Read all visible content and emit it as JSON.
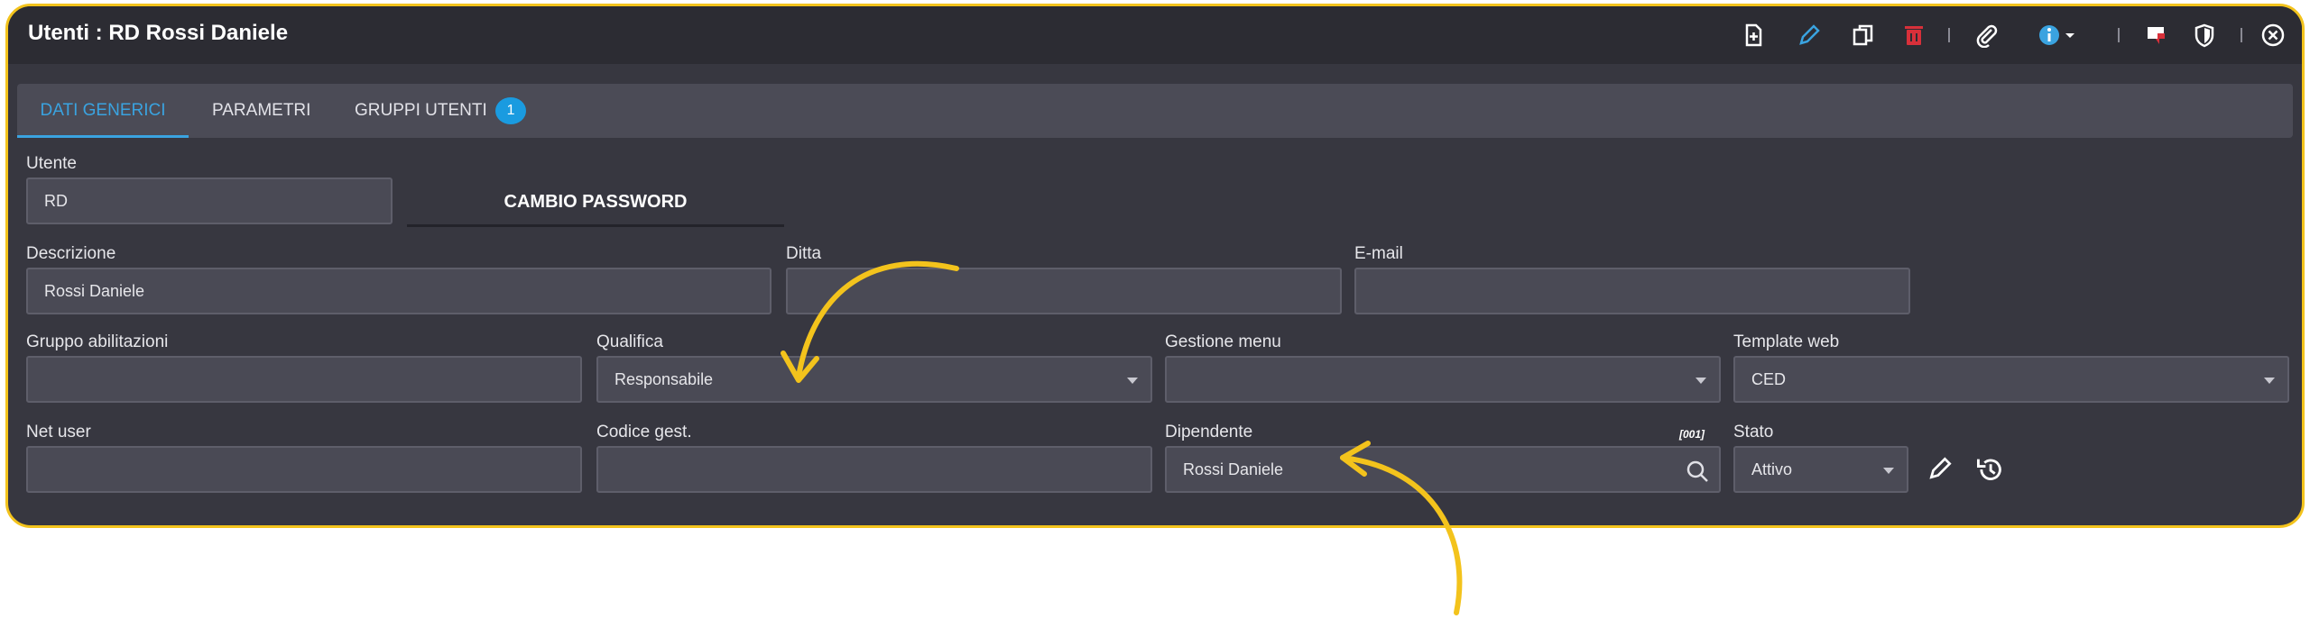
{
  "window": {
    "title": "Utenti : RD Rossi Daniele"
  },
  "toolbar": {
    "icons": [
      "new-document-icon",
      "pencil-icon",
      "copy-icon",
      "delete-icon",
      "paperclip-icon",
      "info-icon",
      "flag-icon",
      "shield-icon",
      "close-icon"
    ]
  },
  "tabs": [
    {
      "label": "DATI GENERICI",
      "active": true
    },
    {
      "label": "PARAMETRI"
    },
    {
      "label": "GRUPPI UTENTI",
      "badge": "1"
    }
  ],
  "form": {
    "utente": {
      "label": "Utente",
      "value": "RD"
    },
    "cambio_password": "CAMBIO PASSWORD",
    "descrizione": {
      "label": "Descrizione",
      "value": "Rossi Daniele"
    },
    "ditta": {
      "label": "Ditta",
      "value": ""
    },
    "email": {
      "label": "E-mail",
      "value": ""
    },
    "gruppo_abilitazioni": {
      "label": "Gruppo abilitazioni",
      "value": ""
    },
    "qualifica": {
      "label": "Qualifica",
      "value": "Responsabile"
    },
    "gestione_menu": {
      "label": "Gestione menu",
      "value": ""
    },
    "template_web": {
      "label": "Template web",
      "value": "CED"
    },
    "net_user": {
      "label": "Net user",
      "value": ""
    },
    "codice_gest": {
      "label": "Codice gest.",
      "value": ""
    },
    "dipendente": {
      "label": "Dipendente",
      "code": "[001]",
      "value": "Rossi Daniele"
    },
    "stato": {
      "label": "Stato",
      "value": "Attivo"
    }
  },
  "colors": {
    "accent": "#f3c31c",
    "tab_active": "#3aa3e0",
    "background": "#373740"
  }
}
